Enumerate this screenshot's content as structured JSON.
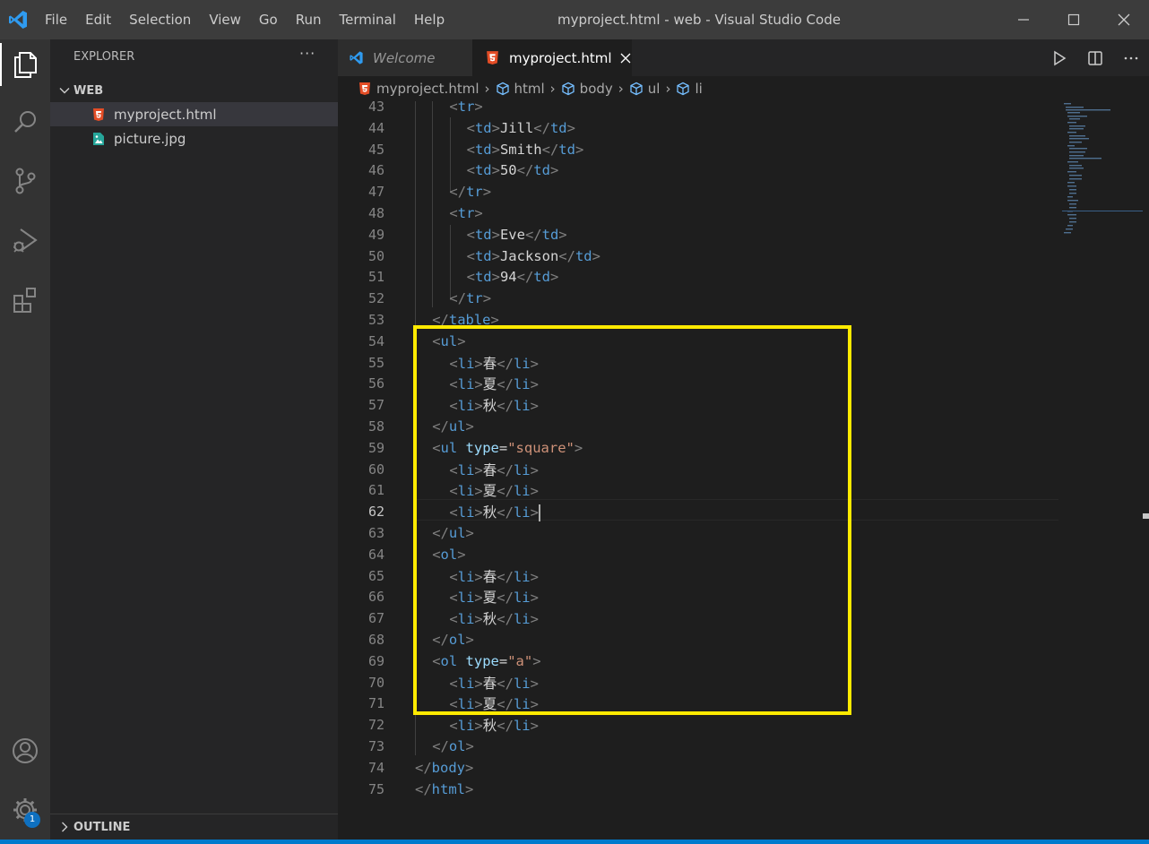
{
  "window": {
    "title": "myproject.html - web - Visual Studio Code",
    "menu": [
      "File",
      "Edit",
      "Selection",
      "View",
      "Go",
      "Run",
      "Terminal",
      "Help"
    ]
  },
  "activity_bar": {
    "items": [
      "explorer-icon",
      "search-icon",
      "source-control-icon",
      "run-debug-icon",
      "extensions-icon"
    ],
    "bottom": [
      "account-icon",
      "settings-gear-icon"
    ],
    "settings_badge": "1"
  },
  "sidebar": {
    "header": "EXPLORER",
    "more": "···",
    "section": "WEB",
    "files": [
      {
        "name": "myproject.html",
        "icon": "html5-file-icon",
        "selected": true
      },
      {
        "name": "picture.jpg",
        "icon": "image-file-icon",
        "selected": false
      }
    ],
    "outline": "OUTLINE"
  },
  "tabs": [
    {
      "label": "Welcome",
      "icon": "vscode-logo-icon",
      "active": false
    },
    {
      "label": "myproject.html",
      "icon": "html5-file-icon",
      "active": true
    }
  ],
  "breadcrumb": [
    "myproject.html",
    "html",
    "body",
    "ul",
    "li"
  ],
  "editor": {
    "current_line": 62,
    "lines": [
      {
        "n": "43",
        "indent": 2,
        "tokens": [
          [
            "br",
            "<"
          ],
          [
            "tag",
            "tr"
          ],
          [
            "br",
            ">"
          ]
        ]
      },
      {
        "n": "44",
        "indent": 3,
        "tokens": [
          [
            "br",
            "<"
          ],
          [
            "tag",
            "td"
          ],
          [
            "br",
            ">"
          ],
          [
            "txt",
            "Jill"
          ],
          [
            "br",
            "</"
          ],
          [
            "tag",
            "td"
          ],
          [
            "br",
            ">"
          ]
        ]
      },
      {
        "n": "45",
        "indent": 3,
        "tokens": [
          [
            "br",
            "<"
          ],
          [
            "tag",
            "td"
          ],
          [
            "br",
            ">"
          ],
          [
            "txt",
            "Smith"
          ],
          [
            "br",
            "</"
          ],
          [
            "tag",
            "td"
          ],
          [
            "br",
            ">"
          ]
        ]
      },
      {
        "n": "46",
        "indent": 3,
        "tokens": [
          [
            "br",
            "<"
          ],
          [
            "tag",
            "td"
          ],
          [
            "br",
            ">"
          ],
          [
            "txt",
            "50"
          ],
          [
            "br",
            "</"
          ],
          [
            "tag",
            "td"
          ],
          [
            "br",
            ">"
          ]
        ]
      },
      {
        "n": "47",
        "indent": 2,
        "tokens": [
          [
            "br",
            "</"
          ],
          [
            "tag",
            "tr"
          ],
          [
            "br",
            ">"
          ]
        ]
      },
      {
        "n": "48",
        "indent": 2,
        "tokens": [
          [
            "br",
            "<"
          ],
          [
            "tag",
            "tr"
          ],
          [
            "br",
            ">"
          ]
        ]
      },
      {
        "n": "49",
        "indent": 3,
        "tokens": [
          [
            "br",
            "<"
          ],
          [
            "tag",
            "td"
          ],
          [
            "br",
            ">"
          ],
          [
            "txt",
            "Eve"
          ],
          [
            "br",
            "</"
          ],
          [
            "tag",
            "td"
          ],
          [
            "br",
            ">"
          ]
        ]
      },
      {
        "n": "50",
        "indent": 3,
        "tokens": [
          [
            "br",
            "<"
          ],
          [
            "tag",
            "td"
          ],
          [
            "br",
            ">"
          ],
          [
            "txt",
            "Jackson"
          ],
          [
            "br",
            "</"
          ],
          [
            "tag",
            "td"
          ],
          [
            "br",
            ">"
          ]
        ]
      },
      {
        "n": "51",
        "indent": 3,
        "tokens": [
          [
            "br",
            "<"
          ],
          [
            "tag",
            "td"
          ],
          [
            "br",
            ">"
          ],
          [
            "txt",
            "94"
          ],
          [
            "br",
            "</"
          ],
          [
            "tag",
            "td"
          ],
          [
            "br",
            ">"
          ]
        ]
      },
      {
        "n": "52",
        "indent": 2,
        "tokens": [
          [
            "br",
            "</"
          ],
          [
            "tag",
            "tr"
          ],
          [
            "br",
            ">"
          ]
        ]
      },
      {
        "n": "53",
        "indent": 1,
        "tokens": [
          [
            "br",
            "</"
          ],
          [
            "tag",
            "table"
          ],
          [
            "br",
            ">"
          ]
        ]
      },
      {
        "n": "54",
        "indent": 1,
        "tokens": [
          [
            "br",
            "<"
          ],
          [
            "tag",
            "ul"
          ],
          [
            "br",
            ">"
          ]
        ]
      },
      {
        "n": "55",
        "indent": 2,
        "tokens": [
          [
            "br",
            "<"
          ],
          [
            "tag",
            "li"
          ],
          [
            "br",
            ">"
          ],
          [
            "txt",
            "春"
          ],
          [
            "br",
            "</"
          ],
          [
            "tag",
            "li"
          ],
          [
            "br",
            ">"
          ]
        ]
      },
      {
        "n": "56",
        "indent": 2,
        "tokens": [
          [
            "br",
            "<"
          ],
          [
            "tag",
            "li"
          ],
          [
            "br",
            ">"
          ],
          [
            "txt",
            "夏"
          ],
          [
            "br",
            "</"
          ],
          [
            "tag",
            "li"
          ],
          [
            "br",
            ">"
          ]
        ]
      },
      {
        "n": "57",
        "indent": 2,
        "tokens": [
          [
            "br",
            "<"
          ],
          [
            "tag",
            "li"
          ],
          [
            "br",
            ">"
          ],
          [
            "txt",
            "秋"
          ],
          [
            "br",
            "</"
          ],
          [
            "tag",
            "li"
          ],
          [
            "br",
            ">"
          ]
        ]
      },
      {
        "n": "58",
        "indent": 1,
        "tokens": [
          [
            "br",
            "</"
          ],
          [
            "tag",
            "ul"
          ],
          [
            "br",
            ">"
          ]
        ]
      },
      {
        "n": "59",
        "indent": 1,
        "tokens": [
          [
            "br",
            "<"
          ],
          [
            "tag",
            "ul"
          ],
          [
            "txt",
            " "
          ],
          [
            "attr",
            "type"
          ],
          [
            "txt",
            "="
          ],
          [
            "str",
            "\"square\""
          ],
          [
            "br",
            ">"
          ]
        ]
      },
      {
        "n": "60",
        "indent": 2,
        "tokens": [
          [
            "br",
            "<"
          ],
          [
            "tag",
            "li"
          ],
          [
            "br",
            ">"
          ],
          [
            "txt",
            "春"
          ],
          [
            "br",
            "</"
          ],
          [
            "tag",
            "li"
          ],
          [
            "br",
            ">"
          ]
        ]
      },
      {
        "n": "61",
        "indent": 2,
        "tokens": [
          [
            "br",
            "<"
          ],
          [
            "tag",
            "li"
          ],
          [
            "br",
            ">"
          ],
          [
            "txt",
            "夏"
          ],
          [
            "br",
            "</"
          ],
          [
            "tag",
            "li"
          ],
          [
            "br",
            ">"
          ]
        ]
      },
      {
        "n": "62",
        "indent": 2,
        "tokens": [
          [
            "br",
            "<"
          ],
          [
            "tag",
            "li"
          ],
          [
            "br",
            ">"
          ],
          [
            "txt",
            "秋"
          ],
          [
            "br",
            "</"
          ],
          [
            "tag",
            "li"
          ],
          [
            "br",
            ">"
          ],
          [
            "cursor",
            ""
          ]
        ]
      },
      {
        "n": "63",
        "indent": 1,
        "tokens": [
          [
            "br",
            "</"
          ],
          [
            "tag",
            "ul"
          ],
          [
            "br",
            ">"
          ]
        ]
      },
      {
        "n": "64",
        "indent": 1,
        "tokens": [
          [
            "br",
            "<"
          ],
          [
            "tag",
            "ol"
          ],
          [
            "br",
            ">"
          ]
        ]
      },
      {
        "n": "65",
        "indent": 2,
        "tokens": [
          [
            "br",
            "<"
          ],
          [
            "tag",
            "li"
          ],
          [
            "br",
            ">"
          ],
          [
            "txt",
            "春"
          ],
          [
            "br",
            "</"
          ],
          [
            "tag",
            "li"
          ],
          [
            "br",
            ">"
          ]
        ]
      },
      {
        "n": "66",
        "indent": 2,
        "tokens": [
          [
            "br",
            "<"
          ],
          [
            "tag",
            "li"
          ],
          [
            "br",
            ">"
          ],
          [
            "txt",
            "夏"
          ],
          [
            "br",
            "</"
          ],
          [
            "tag",
            "li"
          ],
          [
            "br",
            ">"
          ]
        ]
      },
      {
        "n": "67",
        "indent": 2,
        "tokens": [
          [
            "br",
            "<"
          ],
          [
            "tag",
            "li"
          ],
          [
            "br",
            ">"
          ],
          [
            "txt",
            "秋"
          ],
          [
            "br",
            "</"
          ],
          [
            "tag",
            "li"
          ],
          [
            "br",
            ">"
          ]
        ]
      },
      {
        "n": "68",
        "indent": 1,
        "tokens": [
          [
            "br",
            "</"
          ],
          [
            "tag",
            "ol"
          ],
          [
            "br",
            ">"
          ]
        ]
      },
      {
        "n": "69",
        "indent": 1,
        "tokens": [
          [
            "br",
            "<"
          ],
          [
            "tag",
            "ol"
          ],
          [
            "txt",
            " "
          ],
          [
            "attr",
            "type"
          ],
          [
            "txt",
            "="
          ],
          [
            "str",
            "\"a\""
          ],
          [
            "br",
            ">"
          ]
        ]
      },
      {
        "n": "70",
        "indent": 2,
        "tokens": [
          [
            "br",
            "<"
          ],
          [
            "tag",
            "li"
          ],
          [
            "br",
            ">"
          ],
          [
            "txt",
            "春"
          ],
          [
            "br",
            "</"
          ],
          [
            "tag",
            "li"
          ],
          [
            "br",
            ">"
          ]
        ]
      },
      {
        "n": "71",
        "indent": 2,
        "tokens": [
          [
            "br",
            "<"
          ],
          [
            "tag",
            "li"
          ],
          [
            "br",
            ">"
          ],
          [
            "txt",
            "夏"
          ],
          [
            "br",
            "</"
          ],
          [
            "tag",
            "li"
          ],
          [
            "br",
            ">"
          ]
        ]
      },
      {
        "n": "72",
        "indent": 2,
        "tokens": [
          [
            "br",
            "<"
          ],
          [
            "tag",
            "li"
          ],
          [
            "br",
            ">"
          ],
          [
            "txt",
            "秋"
          ],
          [
            "br",
            "</"
          ],
          [
            "tag",
            "li"
          ],
          [
            "br",
            ">"
          ]
        ]
      },
      {
        "n": "73",
        "indent": 1,
        "tokens": [
          [
            "br",
            "</"
          ],
          [
            "tag",
            "ol"
          ],
          [
            "br",
            ">"
          ]
        ]
      },
      {
        "n": "74",
        "indent": 0,
        "tokens": [
          [
            "br",
            "</"
          ],
          [
            "tag",
            "body"
          ],
          [
            "br",
            ">"
          ]
        ]
      },
      {
        "n": "75",
        "indent": 0,
        "tokens": [
          [
            "br",
            "</"
          ],
          [
            "tag",
            "html"
          ],
          [
            "br",
            ">"
          ]
        ]
      }
    ]
  },
  "colors": {
    "highlight_box": "#ffea00",
    "status_bar": "#007acc",
    "tag": "#569cd6",
    "attribute": "#9cdcfe",
    "string": "#ce9178"
  }
}
